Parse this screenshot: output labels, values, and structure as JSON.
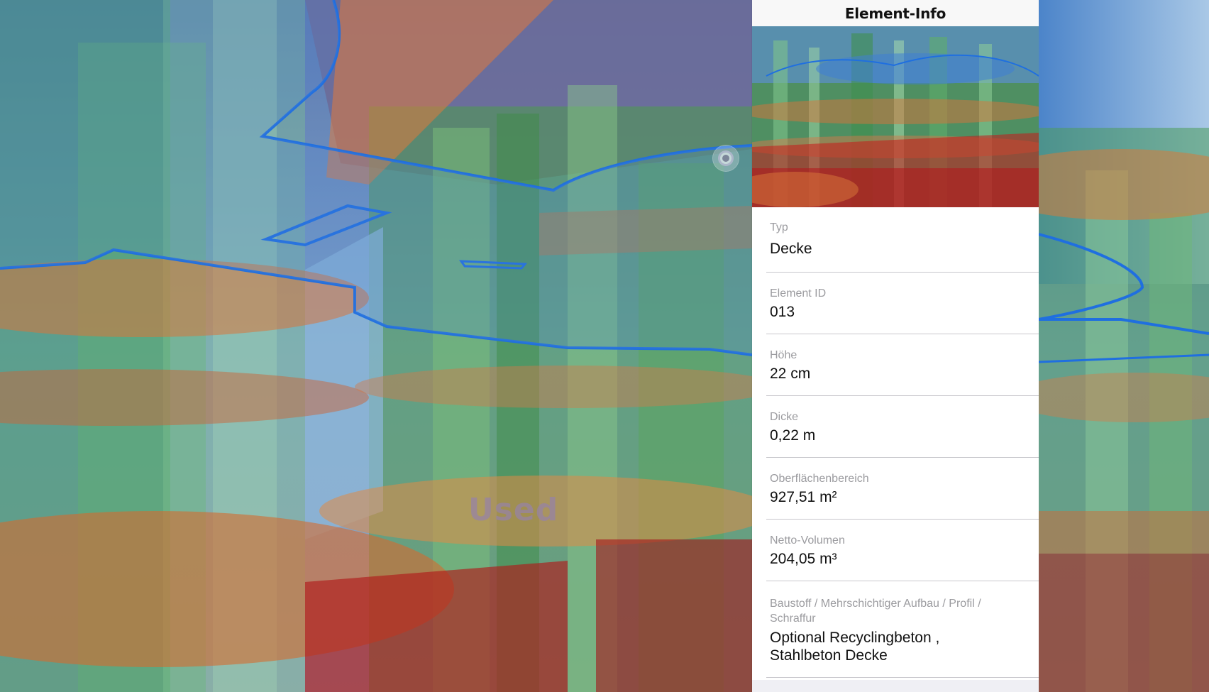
{
  "panel": {
    "title": "Element-Info",
    "properties": [
      {
        "label": "Typ",
        "value": "Decke"
      },
      {
        "label": "Element ID",
        "value": "013"
      },
      {
        "label": "Höhe",
        "value": "22 cm"
      },
      {
        "label": "Dicke",
        "value": "0,22 m"
      },
      {
        "label": "Oberflächenbereich",
        "value": "927,51 m²"
      },
      {
        "label": "Netto-Volumen",
        "value": "204,05 m³"
      },
      {
        "label": "Baustoff / Mehrschichtiger Aufbau / Profil / Schraffur",
        "value": "Optional Recyclingbeton , Stahlbeton Decke"
      }
    ]
  },
  "viewport": {
    "overlay_text": "Used"
  },
  "colors": {
    "panel_background": "#ffffff",
    "label": "#9b9b9f",
    "value": "#111111",
    "outline_blue": "#1f6fe0",
    "slab_orange": "#d9743a",
    "column_green": "#5fae52",
    "wall_red": "#b01a1a",
    "sky": "#6a8fb3"
  },
  "icons": {
    "selection_marker": "target-marker-icon"
  }
}
